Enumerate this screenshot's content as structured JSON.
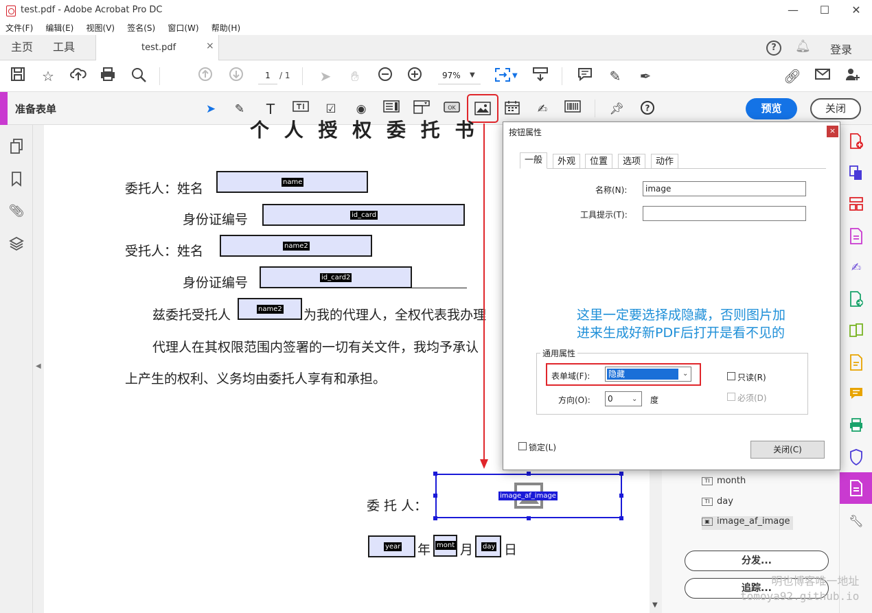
{
  "window": {
    "title": "test.pdf - Adobe Acrobat Pro DC",
    "min": "—",
    "max": "☐",
    "close": "✕"
  },
  "menu": [
    "文件(F)",
    "编辑(E)",
    "视图(V)",
    "签名(S)",
    "窗口(W)",
    "帮助(H)"
  ],
  "tabs": {
    "home": "主页",
    "tools": "工具",
    "doc": "test.pdf",
    "doc_close": "×",
    "login": "登录"
  },
  "toolbar": {
    "page": "1",
    "page_total": "/ 1",
    "zoom": "97%"
  },
  "formbar": {
    "label": "准备表单",
    "preview": "预览",
    "close": "关闭"
  },
  "document": {
    "title_partial": "个 人 授 权 委 托 书",
    "l1": "委托人：姓名",
    "l2": "身份证编号",
    "l3": "受托人：姓名",
    "l4": "身份证编号",
    "p1a": "兹委托受托人",
    "p1b": "为我的代理人，全权代表我办理",
    "p2": "代理人在其权限范围内签署的一切有关文件，我均予承认",
    "p3": "上产生的权利、义务均由委托人享有和承担。",
    "sign": "委 托 人：",
    "year_suffix": "年",
    "month_suffix": "月",
    "day_suffix": "日",
    "fields": {
      "name": "name",
      "id_card": "id_card",
      "name2": "name2",
      "id_card2": "id_card2",
      "name2b": "name2",
      "image": "image_af_image",
      "year": "year",
      "month": "mont",
      "day": "day"
    }
  },
  "dialog": {
    "title": "按钮属性",
    "close": "×",
    "tabs": [
      "一般",
      "外观",
      "位置",
      "选项",
      "动作"
    ],
    "name_label": "名称(N):",
    "name_value": "image",
    "tooltip_label": "工具提示(T):",
    "tooltip_value": "",
    "notice_line1": "这里一定要选择成隐藏，否则图片加",
    "notice_line2": "进来生成好新PDF后打开是看不见的",
    "group_label": "通用属性",
    "form_field_label": "表单域(F):",
    "form_field_value": "隐藏",
    "readonly": "只读(R)",
    "orientation_label": "方向(O):",
    "orientation_value": "0",
    "degree": "度",
    "required": "必须(D)",
    "lock": "锁定(L)",
    "close_button": "关闭(C)"
  },
  "fields_panel": {
    "items": [
      "month",
      "day",
      "image_af_image"
    ],
    "distribute": "分发...",
    "track": "追踪..."
  },
  "watermark": {
    "line1": "明也博客唯一地址",
    "line2": "tomoya92.github.io"
  }
}
